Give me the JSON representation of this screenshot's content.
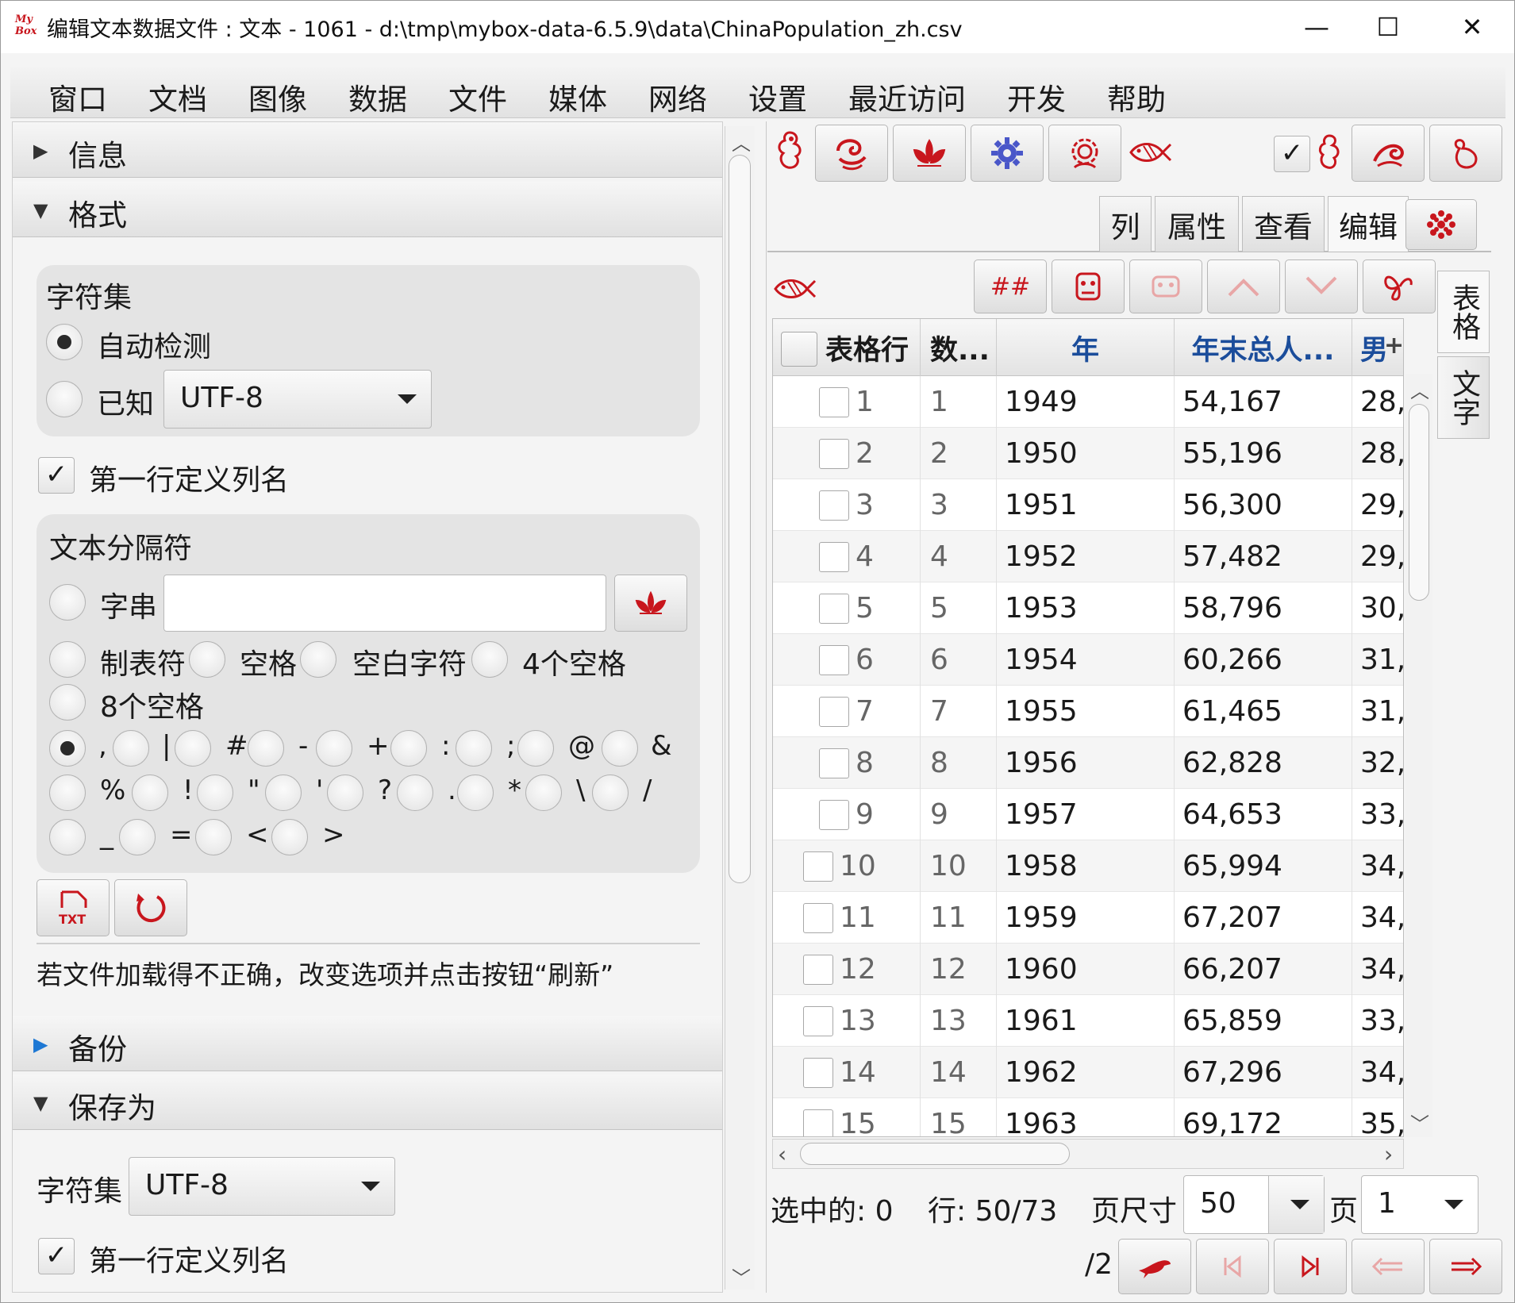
{
  "window": {
    "title": "编辑文本数据文件 : 文本 - 1061 - d:\\tmp\\mybox-data-6.5.9\\data\\ChinaPopulation_zh.csv",
    "app_icon_text": "My Box",
    "minimize": "—",
    "maximize": "☐",
    "close": "✕"
  },
  "menu": [
    "窗口",
    "文档",
    "图像",
    "数据",
    "文件",
    "媒体",
    "网络",
    "设置",
    "最近访问",
    "开发",
    "帮助"
  ],
  "left": {
    "sections": {
      "info": "信息",
      "format": "格式",
      "backup": "备份",
      "save_as": "保存为"
    },
    "charset_group": {
      "title": "字符集",
      "auto_label": "自动检测",
      "known_label": "已知",
      "known_value": "UTF-8"
    },
    "first_row_header": "第一行定义列名",
    "delimiter": {
      "title": "文本分隔符",
      "string_label": "字串",
      "string_value": "",
      "tab_label": "制表符",
      "space_label": "空格",
      "blank_label": "空白字符",
      "four_space_label": "4个空格",
      "eight_space_label": "8个空格",
      "symbols_row1": [
        ",",
        "|",
        "#",
        "-",
        "+",
        ":",
        ";",
        "@",
        "&"
      ],
      "symbols_row2": [
        "%",
        "!",
        "\"",
        "'",
        "?",
        ".",
        "*",
        "\\",
        "/"
      ],
      "symbols_row3": [
        "_",
        "=",
        "<",
        ">"
      ],
      "selected": ","
    },
    "hint": "若文件加载得不正确，改变选项并点击按钮“刷新”",
    "save_as": {
      "charset_label": "字符集",
      "charset_value": "UTF-8",
      "first_row_header": "第一行定义列名"
    }
  },
  "right": {
    "tabs": [
      "列",
      "属性",
      "查看",
      "编辑"
    ],
    "side_tabs": [
      "表格",
      "文字"
    ],
    "toolbar2": {
      "number_button": "##"
    },
    "table": {
      "columns": [
        "表格行",
        "数...",
        "年",
        "年末总人...",
        "男"
      ],
      "rows": [
        {
          "row": "1",
          "num": "1",
          "year": "1949",
          "total": "54,167",
          "male": "28,"
        },
        {
          "row": "2",
          "num": "2",
          "year": "1950",
          "total": "55,196",
          "male": "28,"
        },
        {
          "row": "3",
          "num": "3",
          "year": "1951",
          "total": "56,300",
          "male": "29,"
        },
        {
          "row": "4",
          "num": "4",
          "year": "1952",
          "total": "57,482",
          "male": "29,"
        },
        {
          "row": "5",
          "num": "5",
          "year": "1953",
          "total": "58,796",
          "male": "30,"
        },
        {
          "row": "6",
          "num": "6",
          "year": "1954",
          "total": "60,266",
          "male": "31,"
        },
        {
          "row": "7",
          "num": "7",
          "year": "1955",
          "total": "61,465",
          "male": "31,"
        },
        {
          "row": "8",
          "num": "8",
          "year": "1956",
          "total": "62,828",
          "male": "32,"
        },
        {
          "row": "9",
          "num": "9",
          "year": "1957",
          "total": "64,653",
          "male": "33,"
        },
        {
          "row": "10",
          "num": "10",
          "year": "1958",
          "total": "65,994",
          "male": "34,"
        },
        {
          "row": "11",
          "num": "11",
          "year": "1959",
          "total": "67,207",
          "male": "34,"
        },
        {
          "row": "12",
          "num": "12",
          "year": "1960",
          "total": "66,207",
          "male": "34,"
        },
        {
          "row": "13",
          "num": "13",
          "year": "1961",
          "total": "65,859",
          "male": "33,"
        },
        {
          "row": "14",
          "num": "14",
          "year": "1962",
          "total": "67,296",
          "male": "34,"
        },
        {
          "row": "15",
          "num": "15",
          "year": "1963",
          "total": "69,172",
          "male": "35,"
        }
      ]
    },
    "status": {
      "selected": "选中的: 0",
      "rows": "行: 50/73",
      "page_size_label": "页尺寸",
      "page_size_value": "50",
      "page_label": "页",
      "page_value": "1",
      "page_total": "/2"
    }
  },
  "colors": {
    "accent_red": "#c8161d",
    "header_blue": "#1b4d9b",
    "gear_blue": "#4a57c9"
  }
}
